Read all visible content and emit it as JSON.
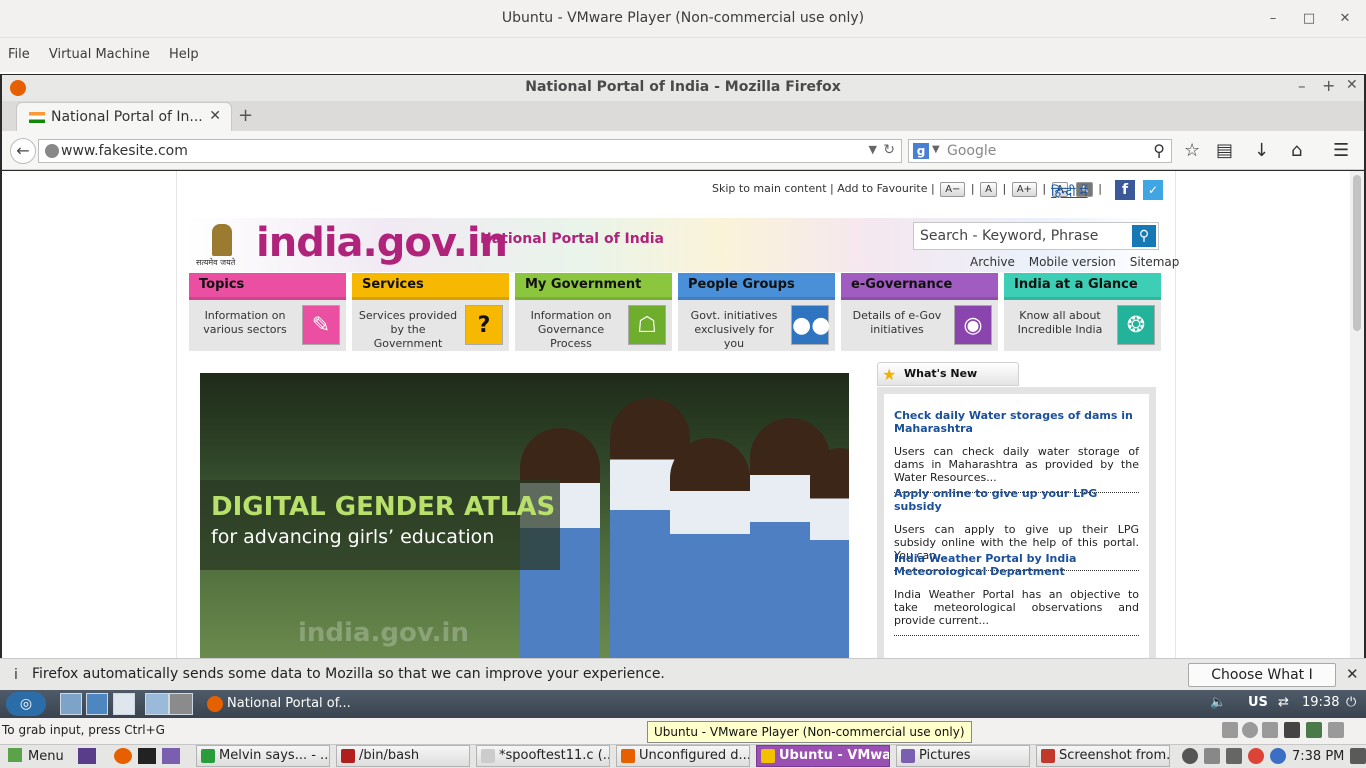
{
  "vmware": {
    "title": "Ubuntu - VMware Player (Non-commercial use only)",
    "menu": [
      "File",
      "Virtual Machine",
      "Help"
    ],
    "status_hint": "To grab input, press Ctrl+G",
    "tooltip": "Ubuntu - VMware Player (Non-commercial use only)"
  },
  "firefox": {
    "window_title": "National Portal of India - Mozilla Firefox",
    "tab_label": "National Portal of In...",
    "url": "www.fakesite.com",
    "search_engine": "Google",
    "search_placeholder": "Google"
  },
  "site": {
    "util_links": [
      "Skip to main content",
      "Add to Favourite"
    ],
    "text_size_buttons": [
      "A−",
      "A",
      "A+"
    ],
    "contrast_buttons": [
      "A",
      "A"
    ],
    "hindi": "हिन्दी में",
    "logo": "india.gov.in",
    "logo_sub": "National Portal of India",
    "emblem_motto": "सत्यमेव जयते",
    "search_placeholder": "Search - Keyword, Phrase",
    "top_links": [
      "Archive",
      "Mobile version",
      "Sitemap"
    ],
    "categories": [
      {
        "title": "Topics",
        "desc": "Information on various sectors",
        "color": "#ea4fa2",
        "icon": "pencil-icon"
      },
      {
        "title": "Services",
        "desc": "Services provided by the Government",
        "color": "#f6b800",
        "icon": "question-icon"
      },
      {
        "title": "My Government",
        "desc": "Information on Governance Process",
        "color": "#8cc63f",
        "icon": "parliament-icon"
      },
      {
        "title": "People Groups",
        "desc": "Govt. initiatives exclusively for you",
        "color": "#4a90d9",
        "icon": "people-icon"
      },
      {
        "title": "e-Governance",
        "desc": "Details of e-Gov initiatives",
        "color": "#a05cc0",
        "icon": "mouse-icon"
      },
      {
        "title": "India at a Glance",
        "desc": "Know all about Incredible India",
        "color": "#3ccfb5",
        "icon": "chakra-icon"
      }
    ],
    "hero": {
      "title": "DIGITAL GENDER ATLAS",
      "subtitle": "for advancing girls’ education",
      "watermark": "india.gov.in"
    },
    "whats_new": {
      "label": "What's New",
      "items": [
        {
          "title": "Check daily Water storages of dams in Maharashtra",
          "desc": "Users can check daily water storage of dams in Maharashtra as provided by the Water Resources..."
        },
        {
          "title": "Apply online to give up your LPG subsidy",
          "desc": "Users can apply to give up their LPG subsidy online with the help of this portal. You can..."
        },
        {
          "title": "India Weather Portal by India Meteorological Department",
          "desc": "India Weather Portal has an objective to take meteorological observations and provide current..."
        }
      ]
    }
  },
  "notification": {
    "message": "Firefox automatically sends some data to Mozilla so that we can improve your experience.",
    "button": "Choose What I Share"
  },
  "guest_panel": {
    "task": "National Portal of...",
    "keyboard": "US",
    "time": "19:38"
  },
  "host_taskbar": {
    "menu": "Menu",
    "tasks": [
      "Melvin says... - ...",
      "/bin/bash",
      "*spooftest11.c (...",
      "Unconfigured d...",
      "Ubuntu - VMwar...",
      "Pictures",
      "Screenshot from..."
    ],
    "active_task": "Ubuntu - VMwar...",
    "clock": "7:38 PM"
  }
}
